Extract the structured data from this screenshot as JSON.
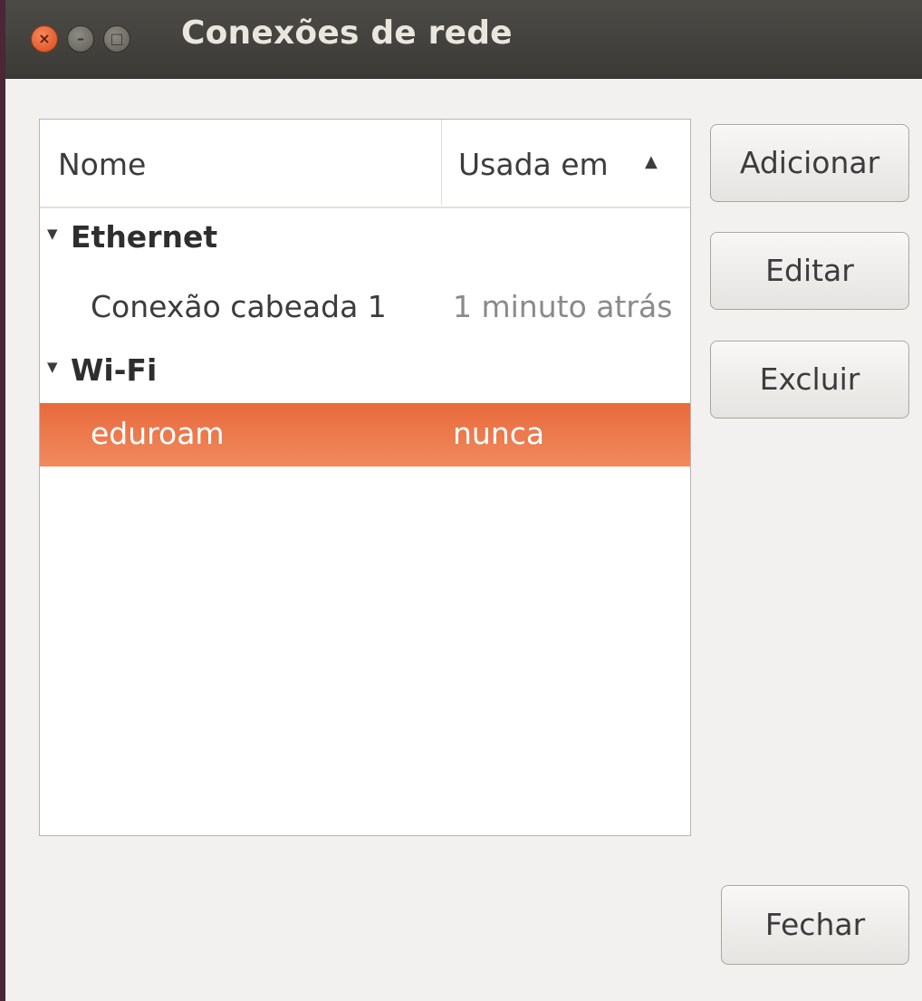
{
  "window": {
    "title": "Conexões de rede",
    "controls": {
      "close_glyph": "×",
      "minimize_glyph": "–",
      "maximize_glyph": "□"
    }
  },
  "list": {
    "columns": {
      "name": "Nome",
      "used": "Usada em",
      "sort_glyph": "▲"
    },
    "groups": [
      {
        "label": "Ethernet",
        "expander": "▼",
        "items": [
          {
            "name": "Conexão cabeada 1",
            "used": "1 minuto atrás",
            "selected": false
          }
        ]
      },
      {
        "label": "Wi-Fi",
        "expander": "▼",
        "items": [
          {
            "name": "eduroam",
            "used": "nunca",
            "selected": true
          }
        ]
      }
    ]
  },
  "buttons": {
    "add": "Adicionar",
    "edit": "Editar",
    "delete": "Excluir",
    "close": "Fechar"
  },
  "colors": {
    "selection": "#e86a3c",
    "titlebar": "#3b3a36",
    "close_button": "#d8491a"
  }
}
